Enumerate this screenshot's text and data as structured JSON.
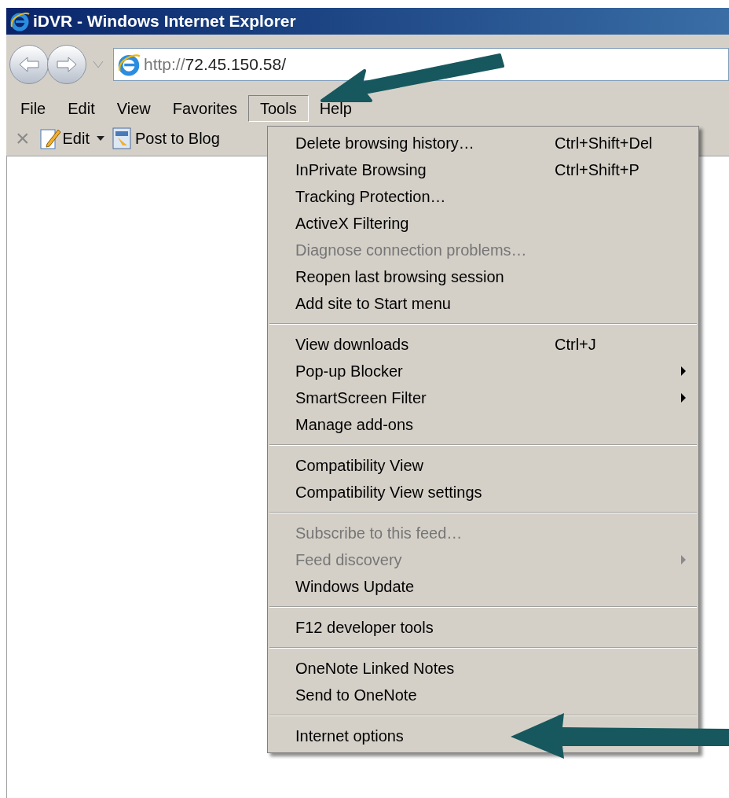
{
  "window": {
    "title": "iDVR - Windows Internet Explorer"
  },
  "address_bar": {
    "scheme": "http://",
    "host": "72.45.150.58/"
  },
  "menu_bar": [
    {
      "label": "File",
      "selected": false
    },
    {
      "label": "Edit",
      "selected": false
    },
    {
      "label": "View",
      "selected": false
    },
    {
      "label": "Favorites",
      "selected": false
    },
    {
      "label": "Tools",
      "selected": true
    },
    {
      "label": "Help",
      "selected": false
    }
  ],
  "toolbar": [
    {
      "kind": "close",
      "label": "×"
    },
    {
      "kind": "edit",
      "label": "Edit"
    },
    {
      "kind": "dropdown"
    },
    {
      "kind": "blog",
      "label": "Post to Blog"
    }
  ],
  "tools_menu": [
    [
      {
        "label": "Delete browsing history…",
        "shortcut": "Ctrl+Shift+Del",
        "disabled": false,
        "submenu": false
      },
      {
        "label": "InPrivate Browsing",
        "shortcut": "Ctrl+Shift+P",
        "disabled": false,
        "submenu": false
      },
      {
        "label": "Tracking Protection…",
        "disabled": false,
        "submenu": false
      },
      {
        "label": "ActiveX Filtering",
        "disabled": false,
        "submenu": false
      },
      {
        "label": "Diagnose connection problems…",
        "disabled": true,
        "submenu": false
      },
      {
        "label": "Reopen last browsing session",
        "disabled": false,
        "submenu": false
      },
      {
        "label": "Add site to Start menu",
        "disabled": false,
        "submenu": false
      }
    ],
    [
      {
        "label": "View downloads",
        "shortcut": "Ctrl+J",
        "disabled": false,
        "submenu": false
      },
      {
        "label": "Pop-up Blocker",
        "disabled": false,
        "submenu": true
      },
      {
        "label": "SmartScreen Filter",
        "disabled": false,
        "submenu": true
      },
      {
        "label": "Manage add-ons",
        "disabled": false,
        "submenu": false
      }
    ],
    [
      {
        "label": "Compatibility View",
        "disabled": false,
        "submenu": false
      },
      {
        "label": "Compatibility View settings",
        "disabled": false,
        "submenu": false
      }
    ],
    [
      {
        "label": "Subscribe to this feed…",
        "disabled": true,
        "submenu": false
      },
      {
        "label": "Feed discovery",
        "disabled": true,
        "submenu": true
      },
      {
        "label": "Windows Update",
        "disabled": false,
        "submenu": false
      }
    ],
    [
      {
        "label": "F12 developer tools",
        "disabled": false,
        "submenu": false
      }
    ],
    [
      {
        "label": "OneNote Linked Notes",
        "disabled": false,
        "submenu": false
      },
      {
        "label": "Send to OneNote",
        "disabled": false,
        "submenu": false
      }
    ],
    [
      {
        "label": "Internet options",
        "disabled": false,
        "submenu": false
      }
    ]
  ]
}
